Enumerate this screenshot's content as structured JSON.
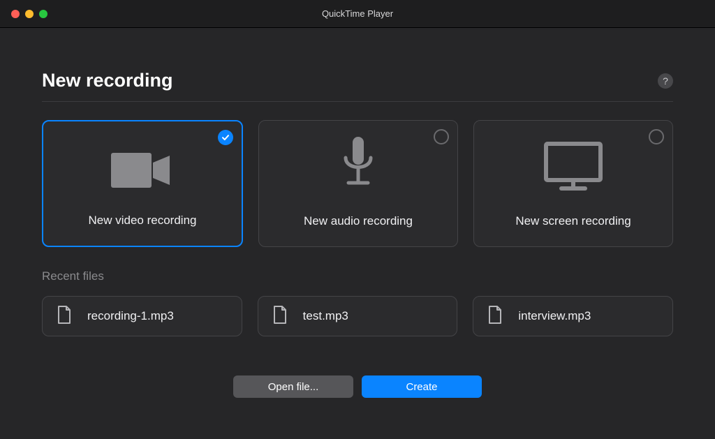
{
  "window": {
    "title": "QuickTime Player"
  },
  "header": {
    "title": "New recording",
    "help_tooltip": "?"
  },
  "options": [
    {
      "label": "New video recording",
      "icon": "video",
      "selected": true
    },
    {
      "label": "New audio recording",
      "icon": "mic",
      "selected": false
    },
    {
      "label": "New screen recording",
      "icon": "screen",
      "selected": false
    }
  ],
  "recent": {
    "section_label": "Recent files",
    "files": [
      {
        "name": "recording-1.mp3"
      },
      {
        "name": "test.mp3"
      },
      {
        "name": "interview.mp3"
      }
    ]
  },
  "footer": {
    "open_label": "Open file...",
    "create_label": "Create"
  }
}
